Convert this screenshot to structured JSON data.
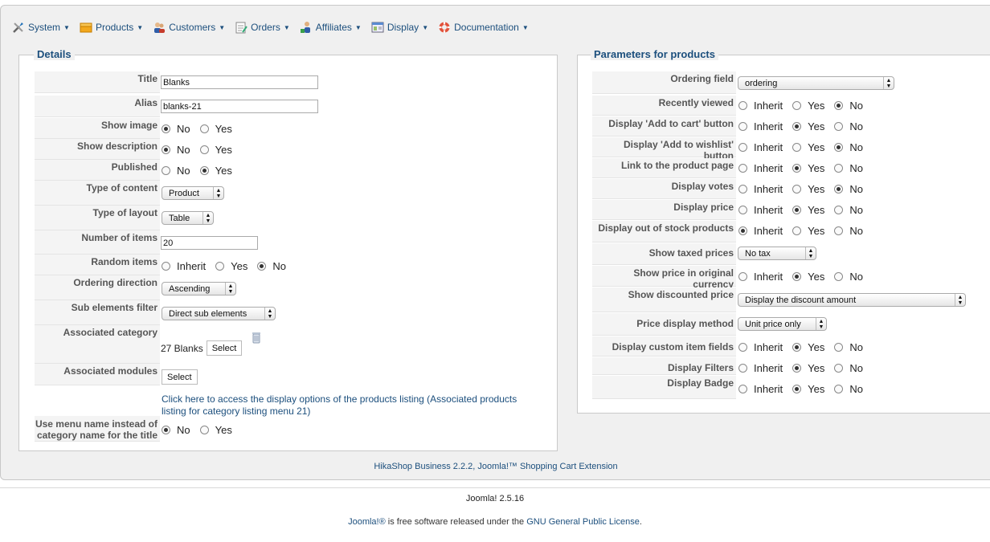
{
  "menu": [
    {
      "label": "System",
      "icon": "tools-icon"
    },
    {
      "label": "Products",
      "icon": "products-box-icon"
    },
    {
      "label": "Customers",
      "icon": "customers-icon"
    },
    {
      "label": "Orders",
      "icon": "orders-icon"
    },
    {
      "label": "Affiliates",
      "icon": "affiliates-icon"
    },
    {
      "label": "Display",
      "icon": "display-icon"
    },
    {
      "label": "Documentation",
      "icon": "lifebuoy-icon"
    }
  ],
  "details": {
    "legend": "Details",
    "title_label": "Title",
    "title_value": "Blanks",
    "alias_label": "Alias",
    "alias_value": "blanks-21",
    "show_image_label": "Show image",
    "show_description_label": "Show description",
    "published_label": "Published",
    "type_content_label": "Type of content",
    "type_content_value": "Product",
    "type_layout_label": "Type of layout",
    "type_layout_value": "Table",
    "number_items_label": "Number of items",
    "number_items_value": "20",
    "random_items_label": "Random items",
    "ordering_direction_label": "Ordering direction",
    "ordering_direction_value": "Ascending",
    "sub_elements_label": "Sub elements filter",
    "sub_elements_value": "Direct sub elements",
    "assoc_category_label": "Associated category",
    "assoc_category_value": "27 Blanks",
    "assoc_modules_label": "Associated modules",
    "select_label": "Select",
    "link_text": "Click here to access the display options of the products listing (Associated products listing for category listing menu 21)",
    "use_menu_label": "Use menu name instead of category name for the title",
    "opt_no": "No",
    "opt_yes": "Yes",
    "opt_inherit": "Inherit"
  },
  "params": {
    "legend": "Parameters for products",
    "ordering_field_label": "Ordering field",
    "ordering_field_value": "ordering",
    "recently_viewed_label": "Recently viewed",
    "add_to_cart_label": "Display 'Add to cart' button",
    "add_to_wishlist_label": "Display 'Add to wishlist' button",
    "link_product_label": "Link to the product page",
    "votes_label": "Display votes",
    "price_label": "Display price",
    "out_of_stock_label": "Display out of stock products",
    "taxed_prices_label": "Show taxed prices",
    "taxed_prices_value": "No tax",
    "original_currency_label": "Show price in original currency",
    "discounted_price_label": "Show discounted price",
    "discounted_price_value": "Display the discount amount",
    "price_method_label": "Price display method",
    "price_method_value": "Unit price only",
    "custom_fields_label": "Display custom item fields",
    "filters_label": "Display Filters",
    "badge_label": "Display Badge",
    "opt_inherit": "Inherit",
    "opt_yes": "Yes",
    "opt_no": "No"
  },
  "footer": {
    "hikashop": "HikaShop Business 2.2.2, Joomla!™ Shopping Cart Extension",
    "version": "Joomla! 2.5.16",
    "license_link1": "Joomla!®",
    "license_mid": " is free software released under the ",
    "license_link2": "GNU General Public License",
    "license_end": "."
  }
}
